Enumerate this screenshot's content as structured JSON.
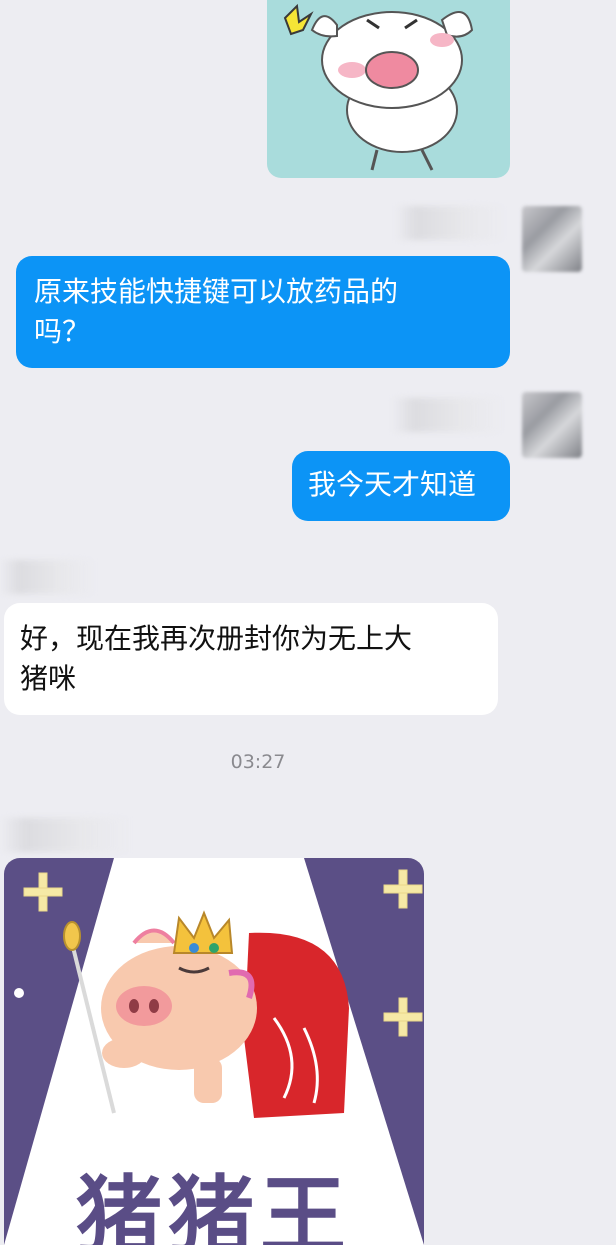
{
  "messages": [
    {
      "text": "原来技能快捷键可以放药品的吗？",
      "line1": "原来技能快捷键可以放药品的",
      "line2": "吗？"
    },
    {
      "text": "我今天才知道"
    },
    {
      "text": "好，现在我再次册封你为无上大猪咪",
      "line1": "好，现在我再次册封你为无上大",
      "line2": "猪咪"
    }
  ],
  "timestamp": "03:27",
  "sticker_caption": "猪猪王",
  "colors": {
    "background": "#ededf2",
    "outgoing_bubble": "#0c94f6",
    "incoming_bubble": "#ffffff",
    "timestamp": "#8a8a8f"
  }
}
